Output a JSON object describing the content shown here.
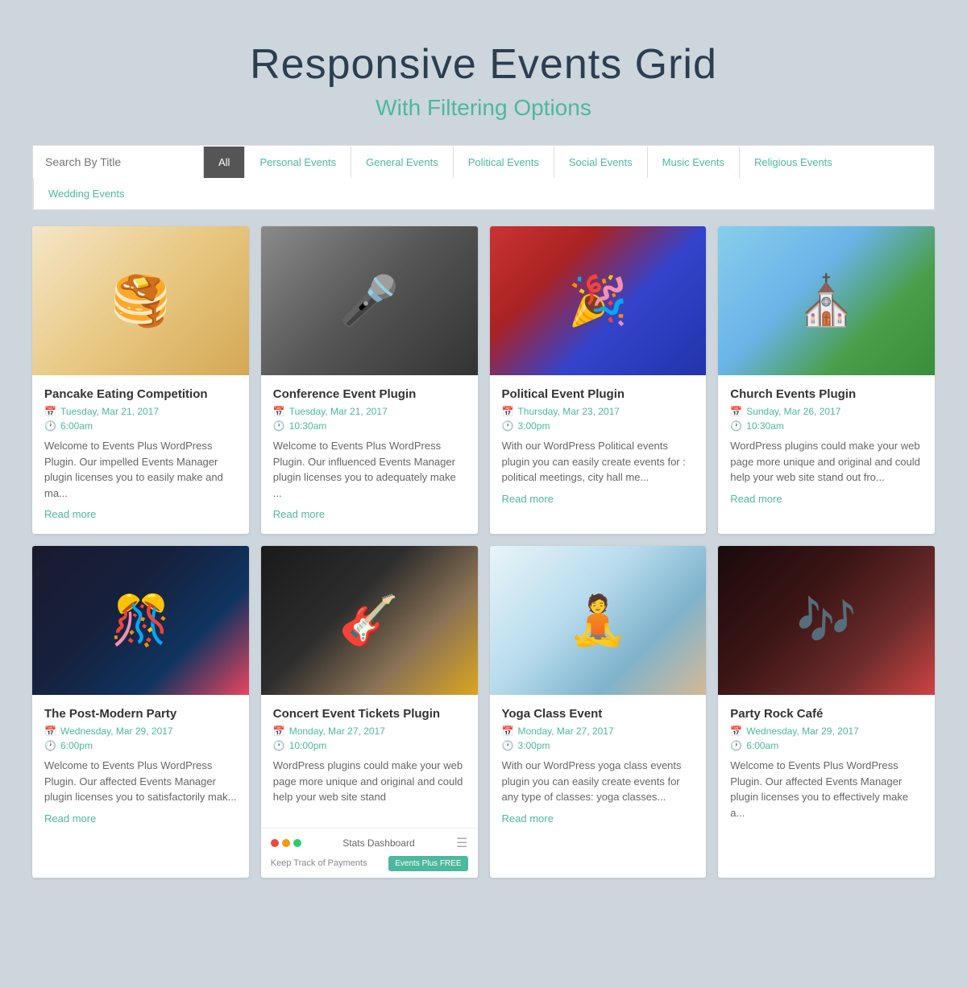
{
  "header": {
    "title": "Responsive Events Grid",
    "subtitle": "With Filtering Options"
  },
  "filter": {
    "search_placeholder": "Search By Title",
    "buttons": [
      {
        "label": "All",
        "active": true
      },
      {
        "label": "Personal Events",
        "active": false
      },
      {
        "label": "General Events",
        "active": false
      },
      {
        "label": "Political Events",
        "active": false
      },
      {
        "label": "Social Events",
        "active": false
      },
      {
        "label": "Music Events",
        "active": false
      },
      {
        "label": "Religious Events",
        "active": false
      },
      {
        "label": "Wedding Events",
        "active": false
      }
    ]
  },
  "events": [
    {
      "id": 1,
      "title": "Pancake Eating Competition",
      "date": "Tuesday, Mar 21, 2017",
      "time": "6:00am",
      "description": "Welcome to Events Plus WordPress Plugin. Our impelled Events Manager plugin licenses you to easily make and ma...",
      "read_more": "Read more",
      "img_class": "img-pancake",
      "img_emoji": "🥞"
    },
    {
      "id": 2,
      "title": "Conference Event Plugin",
      "date": "Tuesday, Mar 21, 2017",
      "time": "10:30am",
      "description": "Welcome to Events Plus WordPress Plugin. Our influenced Events Manager plugin licenses you to adequately make ...",
      "read_more": "Read more",
      "img_class": "img-conference",
      "img_emoji": "🎤"
    },
    {
      "id": 3,
      "title": "Political Event Plugin",
      "date": "Thursday, Mar 23, 2017",
      "time": "3:00pm",
      "description": "With our WordPress Political events plugin you can easily create events for : political meetings, city hall me...",
      "read_more": "Read more",
      "img_class": "img-political",
      "img_emoji": "🎉"
    },
    {
      "id": 4,
      "title": "Church Events Plugin",
      "date": "Sunday, Mar 26, 2017",
      "time": "10:30am",
      "description": "WordPress plugins could make your web page more unique and original and could help your web site stand out fro...",
      "read_more": "Read more",
      "img_class": "img-church",
      "img_emoji": "⛪"
    },
    {
      "id": 5,
      "title": "The Post-Modern Party",
      "date": "Wednesday, Mar 29, 2017",
      "time": "6:00pm",
      "description": "Welcome to Events Plus WordPress Plugin. Our affected Events Manager plugin licenses you to satisfactorily mak...",
      "read_more": "Read more",
      "img_class": "img-party",
      "img_emoji": "🎊"
    },
    {
      "id": 6,
      "title": "Concert Event Tickets Plugin",
      "date": "Monday, Mar 27, 2017",
      "time": "10:00pm",
      "description": "WordPress plugins could make your web page more unique and original and could help your web site stand",
      "read_more": "",
      "img_class": "img-concert",
      "img_emoji": "🎸"
    },
    {
      "id": 7,
      "title": "Yoga Class Event",
      "date": "Monday, Mar 27, 2017",
      "time": "3:00pm",
      "description": "With our WordPress yoga class events plugin you can easily create events for any type of classes: yoga classes...",
      "read_more": "Read more",
      "img_class": "img-yoga",
      "img_emoji": "🧘"
    },
    {
      "id": 8,
      "title": "Party Rock Café",
      "date": "Wednesday, Mar 29, 2017",
      "time": "6:00am",
      "description": "Welcome to Events Plus WordPress Plugin. Our affected Events Manager plugin licenses you to effectively make a...",
      "read_more": "",
      "img_class": "img-cafe",
      "img_emoji": "🎶"
    }
  ],
  "stats": {
    "title": "Stats Dashboard",
    "keep_track": "Keep Track of Payments",
    "free_btn": "Events Plus FREE",
    "dots": [
      "#e74c3c",
      "#f39c12",
      "#2ecc71"
    ]
  }
}
